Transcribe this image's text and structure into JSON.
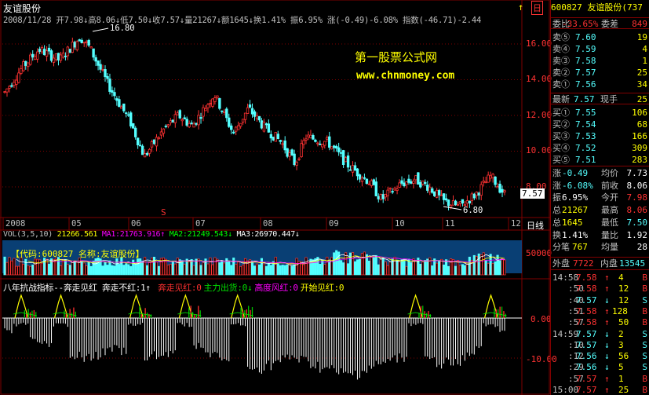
{
  "header": {
    "stock_name": "友谊股份",
    "info_line": "2008/11/28 开7.98↓高8.06↓低7.50↓收7.57↓量21267↓额1645↓换1.41% 振6.95% 涨(-0.49)-6.08% 指数(-46.71)-2.44",
    "top_icons": [
      "↑",
      "日"
    ]
  },
  "watermark": {
    "line1": "第一股票公式网",
    "line2": "www.chnmoney.com"
  },
  "price_axis": {
    "labels": [
      "16.00",
      "14.00",
      "12.00",
      "10.00",
      "8.00"
    ],
    "current_price": "7.57"
  },
  "annotations": {
    "high": "16.80",
    "low": "6.80",
    "marker": "S"
  },
  "time_axis": {
    "labels": [
      "2008",
      "05",
      "06",
      "07",
      "08",
      "09",
      "10",
      "11",
      "12"
    ],
    "period": "日线"
  },
  "volume": {
    "title": "VOL(3,5,10) ",
    "val": "21266.561",
    "ma1": "MA1:21763.916↑",
    "ma2": "MA2:21249.543↓",
    "ma3": "MA3:26970.447↓",
    "code_label": "【代码:600827 名称:友谊股份】",
    "axis_label": "50000"
  },
  "indicator": {
    "title": "八年抗战指标--奔走见红 奔走不红:1↑",
    "items": [
      {
        "text": "奔走见红:0",
        "color": "#ff3030"
      },
      {
        "text": "主力出货:0↓",
        "color": "#00e000"
      },
      {
        "text": "高度风红:0",
        "color": "#ff00ff"
      },
      {
        "text": "开始见红:0",
        "color": "#ffff00"
      }
    ],
    "axis_labels": [
      "0.00",
      "-10.00"
    ]
  },
  "quote_panel": {
    "title": "600827 友谊股份(737",
    "committee_ratio_label": "委比",
    "committee_ratio": "-33.65%",
    "committee_diff_label": "委差",
    "committee_diff": "849",
    "asks": [
      {
        "label": "卖⑤",
        "price": "7.60",
        "vol": "19"
      },
      {
        "label": "卖④",
        "price": "7.59",
        "vol": "4"
      },
      {
        "label": "卖③",
        "price": "7.58",
        "vol": "1"
      },
      {
        "label": "卖②",
        "price": "7.57",
        "vol": "25"
      },
      {
        "label": "卖①",
        "price": "7.56",
        "vol": "34"
      }
    ],
    "last_label": "最新",
    "last_price": "7.57",
    "hand_label": "现手",
    "hand": "25",
    "bids": [
      {
        "label": "买①",
        "price": "7.55",
        "vol": "106"
      },
      {
        "label": "买②",
        "price": "7.54",
        "vol": "68"
      },
      {
        "label": "买③",
        "price": "7.53",
        "vol": "166"
      },
      {
        "label": "买④",
        "price": "7.52",
        "vol": "309"
      },
      {
        "label": "买⑤",
        "price": "7.51",
        "vol": "283"
      }
    ],
    "stats": [
      {
        "l1": "涨",
        "v1": "-0.49",
        "l2": "均价",
        "v2": "7.73"
      },
      {
        "l1": "涨",
        "v1": "-6.08%",
        "l2": "前收",
        "v2": "8.06"
      },
      {
        "l1": "振",
        "v1": "6.95%",
        "l2": "今开",
        "v2": "7.98"
      },
      {
        "l1": "总",
        "v1": "21267",
        "l2": "最高",
        "v2": "8.06"
      },
      {
        "l1": "总",
        "v1": "1645",
        "l2": "最低",
        "v2": "7.50"
      },
      {
        "l1": "换",
        "v1": "1.41%",
        "l2": "量比",
        "v2": "1.92"
      },
      {
        "l1": "分笔",
        "v1": "767",
        "l2": "均量",
        "v2": "28"
      }
    ],
    "outer_label": "外盘",
    "outer": "7722",
    "inner_label": "内盘",
    "inner": "13545",
    "ticks": [
      {
        "time": "14:58",
        "price": "7.58",
        "vol": "4",
        "dir": "B"
      },
      {
        "time": ":50",
        "price": "7.58",
        "vol": "12",
        "dir": "B"
      },
      {
        "time": ":40",
        "price": "7.57",
        "vol": "12",
        "dir": "S"
      },
      {
        "time": ":51",
        "price": "7.58",
        "vol": "128",
        "dir": "B"
      },
      {
        "time": ":57",
        "price": "7.58",
        "vol": "50",
        "dir": "B"
      },
      {
        "time": "14:59",
        "price": "7.57",
        "vol": "2",
        "dir": "S"
      },
      {
        "time": ":10",
        "price": "7.57",
        "vol": "3",
        "dir": "S"
      },
      {
        "time": ":12",
        "price": "7.56",
        "vol": "56",
        "dir": "S"
      },
      {
        "time": ":29",
        "price": "7.56",
        "vol": "5",
        "dir": "S"
      },
      {
        "time": ":57",
        "price": "7.57",
        "vol": "1",
        "dir": "B"
      },
      {
        "time": "15:00",
        "price": "7.57",
        "vol": "25",
        "dir": "B"
      }
    ]
  },
  "colors": {
    "up": "#ff3232",
    "down": "#54ffff",
    "grid": "#800000",
    "axis_text": "#c0c0c0",
    "watermark": "#ffff00",
    "ma1": "#ffffff",
    "ma2": "#ffff00",
    "ma3": "#ff00ff",
    "volume_band": "#0a5aa0"
  }
}
